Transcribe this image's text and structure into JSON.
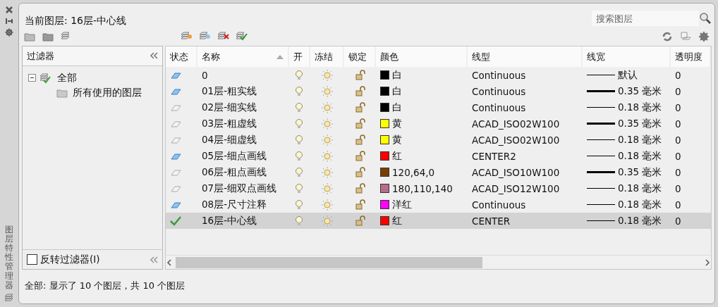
{
  "side_title": "图层特性管理器",
  "current_layer": "当前图层: 16层-中心线",
  "search": {
    "placeholder": "搜索图层"
  },
  "filter_panel": {
    "title": "过滤器",
    "tree": [
      {
        "label": "全部",
        "expanded": true,
        "children": [
          {
            "label": "所有使用的图层"
          }
        ]
      }
    ],
    "invert": {
      "label": "反转过滤器(I)",
      "checked": false
    }
  },
  "table": {
    "columns": [
      "状态",
      "名称",
      "开",
      "冻结",
      "锁定",
      "颜色",
      "线型",
      "线宽",
      "透明度"
    ],
    "rows": [
      {
        "kind": "used",
        "name": "0",
        "color": "#000000",
        "color_name": "白",
        "linetype": "Continuous",
        "lineweight": "默认",
        "thick": false,
        "transparency": "0",
        "selected": false
      },
      {
        "kind": "used",
        "name": "01层-粗实线",
        "color": "#000000",
        "color_name": "白",
        "linetype": "Continuous",
        "lineweight": "0.35 毫米",
        "thick": true,
        "transparency": "0",
        "selected": false
      },
      {
        "kind": "unused",
        "name": "02层-细实线",
        "color": "#000000",
        "color_name": "白",
        "linetype": "Continuous",
        "lineweight": "0.18 毫米",
        "thick": false,
        "transparency": "0",
        "selected": false
      },
      {
        "kind": "unused",
        "name": "03层-粗虚线",
        "color": "#ffff00",
        "color_name": "黄",
        "linetype": "ACAD_ISO02W100",
        "lineweight": "0.35 毫米",
        "thick": true,
        "transparency": "0",
        "selected": false
      },
      {
        "kind": "unused",
        "name": "04层-细虚线",
        "color": "#ffff00",
        "color_name": "黄",
        "linetype": "ACAD_ISO02W100",
        "lineweight": "0.18 毫米",
        "thick": false,
        "transparency": "0",
        "selected": false
      },
      {
        "kind": "used",
        "name": "05层-细点画线",
        "color": "#ff0000",
        "color_name": "红",
        "linetype": "CENTER2",
        "lineweight": "0.18 毫米",
        "thick": false,
        "transparency": "0",
        "selected": false
      },
      {
        "kind": "unused",
        "name": "06层-粗点画线",
        "color": "#784000",
        "color_name": "120,64,0",
        "linetype": "ACAD_ISO10W100",
        "lineweight": "0.35 毫米",
        "thick": true,
        "transparency": "0",
        "selected": false
      },
      {
        "kind": "unused",
        "name": "07层-细双点画线",
        "color": "#b46e8c",
        "color_name": "180,110,140",
        "linetype": "ACAD_ISO12W100",
        "lineweight": "0.18 毫米",
        "thick": false,
        "transparency": "0",
        "selected": false
      },
      {
        "kind": "used",
        "name": "08层-尺寸注释",
        "color": "#ff00ff",
        "color_name": "洋红",
        "linetype": "Continuous",
        "lineweight": "0.18 毫米",
        "thick": false,
        "transparency": "0",
        "selected": false
      },
      {
        "kind": "current",
        "name": "16层-中心线",
        "color": "#ff0000",
        "color_name": "红",
        "linetype": "CENTER",
        "lineweight": "0.18 毫米",
        "thick": false,
        "transparency": "0",
        "selected": true
      }
    ]
  },
  "status_bar": "全部: 显示了 10 个图层，共 10 个图层"
}
